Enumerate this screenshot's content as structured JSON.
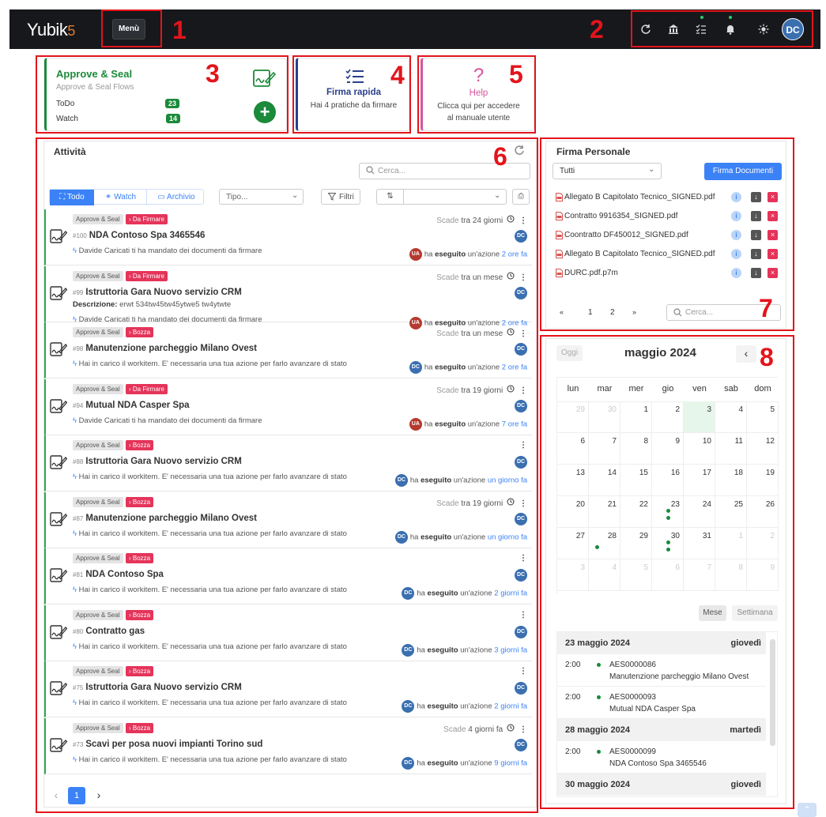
{
  "topbar": {
    "logo": "Yubik",
    "logo_suffix": "5",
    "menu_label": "Menù",
    "user_initials": "DC",
    "icons": [
      "refresh-icon",
      "bank-icon",
      "checklist-icon",
      "bell-icon",
      "sun-icon"
    ]
  },
  "annotations": [
    "1",
    "2",
    "3",
    "4",
    "5",
    "6",
    "7",
    "8"
  ],
  "cards": {
    "approve": {
      "title": "Approve & Seal",
      "subtitle": "Approve & Seal Flows",
      "todo_label": "ToDo",
      "todo_count": "23",
      "watch_label": "Watch",
      "watch_count": "14"
    },
    "firma": {
      "title": "Firma rapida",
      "text": "Hai 4 pratiche da firmare"
    },
    "help": {
      "icon": "?",
      "title": "Help",
      "line1": "Clicca qui per accedere",
      "line2": "al manuale utente"
    }
  },
  "activity": {
    "title": "Attività",
    "search_placeholder": "Cerca...",
    "tabs": [
      {
        "label": "Todo",
        "icon": "todo-icon",
        "active": true
      },
      {
        "label": "Watch",
        "icon": "binoculars-icon",
        "active": false
      },
      {
        "label": "Archivio",
        "icon": "archive-icon",
        "active": false
      }
    ],
    "type_placeholder": "Tipo...",
    "filter_label": "Filtri",
    "rows": [
      {
        "tag": "Approve & Seal",
        "status": "Da Firmare",
        "due_label": "Scade",
        "due": "tra 24 giorni",
        "num": "#100",
        "title": "NDA Contoso Spa 3465546",
        "desc_label": "",
        "desc": "",
        "message": "Davide Caricati ti ha mandato dei documenti da firmare",
        "avatar": "UA",
        "action_pre": "ha",
        "action_bold": "eseguito",
        "action_post": "un'azione",
        "time": "2 ore fa"
      },
      {
        "tag": "Approve & Seal",
        "status": "Da Firmare",
        "due_label": "Scade",
        "due": "tra un mese",
        "num": "#99",
        "title": "Istruttoria Gara Nuovo servizio CRM",
        "desc_label": "Descrizione:",
        "desc": "erwt 534tw45tw45ytwe5 tw4ytwte",
        "message": "Davide Caricati ti ha mandato dei documenti da firmare",
        "avatar": "UA",
        "action_pre": "ha",
        "action_bold": "eseguito",
        "action_post": "un'azione",
        "time": "2 ore fa"
      },
      {
        "tag": "Approve & Seal",
        "status": "Bozza",
        "due_label": "Scade",
        "due": "tra un mese",
        "num": "#98",
        "title": "Manutenzione parcheggio Milano Ovest",
        "desc_label": "",
        "desc": "",
        "message": "Hai in carico il workitem. E' necessaria una tua azione per farlo avanzare di stato",
        "avatar": "DC",
        "action_pre": "ha",
        "action_bold": "eseguito",
        "action_post": "un'azione",
        "time": "2 ore fa"
      },
      {
        "tag": "Approve & Seal",
        "status": "Da Firmare",
        "due_label": "Scade",
        "due": "tra 19 giorni",
        "num": "#94",
        "title": "Mutual NDA Casper Spa",
        "desc_label": "",
        "desc": "",
        "message": "Davide Caricati ti ha mandato dei documenti da firmare",
        "avatar": "UA",
        "action_pre": "ha",
        "action_bold": "eseguito",
        "action_post": "un'azione",
        "time": "7 ore fa"
      },
      {
        "tag": "Approve & Seal",
        "status": "Bozza",
        "due_label": "",
        "due": "",
        "num": "#88",
        "title": "Istruttoria Gara Nuovo servizio CRM",
        "desc_label": "",
        "desc": "",
        "message": "Hai in carico il workitem. E' necessaria una tua azione per farlo avanzare di stato",
        "avatar": "DC",
        "action_pre": "ha",
        "action_bold": "eseguito",
        "action_post": "un'azione",
        "time": "un giorno fa"
      },
      {
        "tag": "Approve & Seal",
        "status": "Bozza",
        "due_label": "Scade",
        "due": "tra 19 giorni",
        "num": "#87",
        "title": "Manutenzione parcheggio Milano Ovest",
        "desc_label": "",
        "desc": "",
        "message": "Hai in carico il workitem. E' necessaria una tua azione per farlo avanzare di stato",
        "avatar": "DC",
        "action_pre": "ha",
        "action_bold": "eseguito",
        "action_post": "un'azione",
        "time": "un giorno fa"
      },
      {
        "tag": "Approve & Seal",
        "status": "Bozza",
        "due_label": "",
        "due": "",
        "num": "#81",
        "title": "NDA Contoso Spa",
        "desc_label": "",
        "desc": "",
        "message": "Hai in carico il workitem. E' necessaria una tua azione per farlo avanzare di stato",
        "avatar": "DC",
        "action_pre": "ha",
        "action_bold": "eseguito",
        "action_post": "un'azione",
        "time": "2 giorni fa"
      },
      {
        "tag": "Approve & Seal",
        "status": "Bozza",
        "due_label": "",
        "due": "",
        "num": "#80",
        "title": "Contratto gas",
        "desc_label": "",
        "desc": "",
        "message": "Hai in carico il workitem. E' necessaria una tua azione per farlo avanzare di stato",
        "avatar": "DC",
        "action_pre": "ha",
        "action_bold": "eseguito",
        "action_post": "un'azione",
        "time": "3 giorni fa"
      },
      {
        "tag": "Approve & Seal",
        "status": "Bozza",
        "due_label": "",
        "due": "",
        "num": "#75",
        "title": "Istruttoria Gara Nuovo servizio CRM",
        "desc_label": "",
        "desc": "",
        "message": "Hai in carico il workitem. E' necessaria una tua azione per farlo avanzare di stato",
        "avatar": "DC",
        "action_pre": "ha",
        "action_bold": "eseguito",
        "action_post": "un'azione",
        "time": "2 giorni fa"
      },
      {
        "tag": "Approve & Seal",
        "status": "Bozza",
        "due_label": "Scade",
        "due": "4 giorni fa",
        "num": "#73",
        "title": "Scavi per posa nuovi impianti Torino sud",
        "desc_label": "",
        "desc": "",
        "message": "Hai in carico il workitem. E' necessaria una tua azione per farlo avanzare di stato",
        "avatar": "DC",
        "action_pre": "ha",
        "action_bold": "eseguito",
        "action_post": "un'azione",
        "time": "9 giorni fa"
      }
    ],
    "pagination": {
      "prev": "‹",
      "current": "1",
      "next": "›"
    }
  },
  "firma_personale": {
    "title": "Firma Personale",
    "select_value": "Tutti",
    "button_label": "Firma Documenti",
    "files": [
      "Allegato B Capitolato Tecnico_SIGNED.pdf",
      "Contratto 9916354_SIGNED.pdf",
      "Coontratto DF450012_SIGNED.pdf",
      "Allegato B Capitolato Tecnico_SIGNED.pdf",
      "DURC.pdf.p7m"
    ],
    "pagination": [
      "«",
      "1",
      "2",
      "»"
    ],
    "search_placeholder": "Cerca..."
  },
  "calendar": {
    "today_label": "Oggi",
    "month_title": "maggio 2024",
    "weekdays": [
      "lun",
      "mar",
      "mer",
      "gio",
      "ven",
      "sab",
      "dom"
    ],
    "weeks": [
      [
        [
          "29",
          1
        ],
        [
          "30",
          1
        ],
        [
          "1",
          0
        ],
        [
          "2",
          0
        ],
        [
          "3",
          0
        ],
        [
          "4",
          0
        ],
        [
          "5",
          0
        ]
      ],
      [
        [
          "6",
          0
        ],
        [
          "7",
          0
        ],
        [
          "8",
          0
        ],
        [
          "9",
          0
        ],
        [
          "10",
          0
        ],
        [
          "11",
          0
        ],
        [
          "12",
          0
        ]
      ],
      [
        [
          "13",
          0
        ],
        [
          "14",
          0
        ],
        [
          "15",
          0
        ],
        [
          "16",
          0
        ],
        [
          "17",
          0
        ],
        [
          "18",
          0
        ],
        [
          "19",
          0
        ]
      ],
      [
        [
          "20",
          0
        ],
        [
          "21",
          0
        ],
        [
          "22",
          0
        ],
        [
          "23",
          0
        ],
        [
          "24",
          0
        ],
        [
          "25",
          0
        ],
        [
          "26",
          0
        ]
      ],
      [
        [
          "27",
          0
        ],
        [
          "28",
          0
        ],
        [
          "29",
          0
        ],
        [
          "30",
          0
        ],
        [
          "31",
          0
        ],
        [
          "1",
          1
        ],
        [
          "2",
          1
        ]
      ],
      [
        [
          "3",
          1
        ],
        [
          "4",
          1
        ],
        [
          "5",
          1
        ],
        [
          "6",
          1
        ],
        [
          "7",
          1
        ],
        [
          "8",
          1
        ],
        [
          "9",
          1
        ]
      ]
    ],
    "today": [
      0,
      4
    ],
    "event_dots": [
      [
        3,
        3,
        2
      ],
      [
        4,
        1,
        1
      ],
      [
        4,
        3,
        2
      ]
    ],
    "view_month": "Mese",
    "view_week": "Settimana",
    "event_groups": [
      {
        "date": "23 maggio 2024",
        "day": "giovedì",
        "events": [
          {
            "time": "2:00",
            "code": "AES0000086",
            "title": "Manutenzione parcheggio Milano Ovest"
          },
          {
            "time": "2:00",
            "code": "AES0000093",
            "title": "Mutual NDA Casper Spa"
          }
        ]
      },
      {
        "date": "28 maggio 2024",
        "day": "martedì",
        "events": [
          {
            "time": "2:00",
            "code": "AES0000099",
            "title": "NDA Contoso Spa 3465546"
          }
        ]
      },
      {
        "date": "30 maggio 2024",
        "day": "giovedì",
        "events": []
      }
    ]
  },
  "colors": {
    "accent": "#3b82f6",
    "green": "#1b8a3a",
    "danger": "#e5345a",
    "annotation": "#e3141b"
  }
}
